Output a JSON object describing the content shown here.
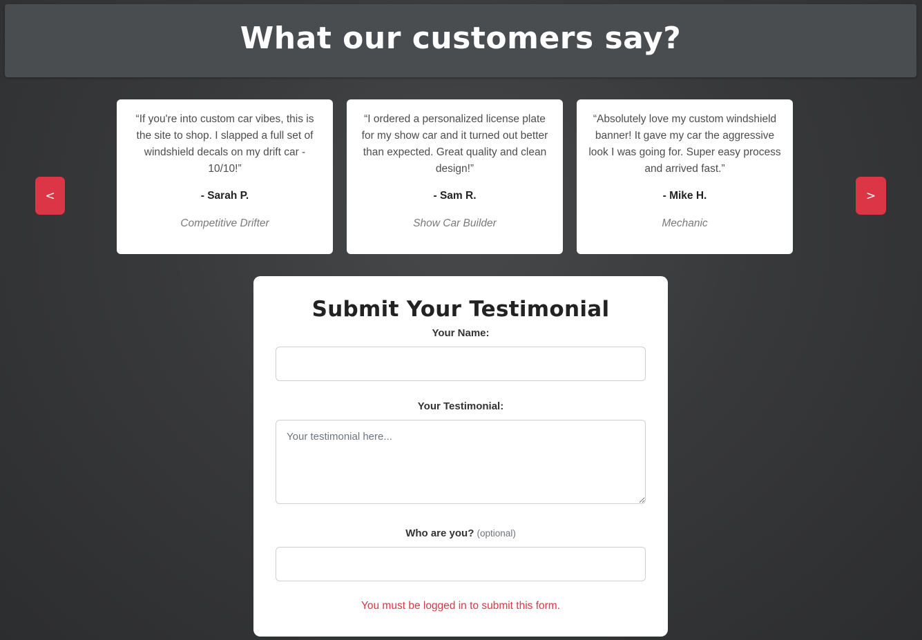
{
  "header": {
    "title": "What our customers say?"
  },
  "carousel": {
    "prev_label": "<",
    "next_label": ">",
    "testimonials": [
      {
        "quote": "“If you're into custom car vibes, this is the site to shop. I slapped a full set of windshield decals on my drift car - 10/10!”",
        "author": "- Sarah P.",
        "role": "Competitive Drifter"
      },
      {
        "quote": "“I ordered a personalized license plate for my show car and it turned out better than expected. Great quality and clean design!”",
        "author": "- Sam R.",
        "role": "Show Car Builder"
      },
      {
        "quote": "“Absolutely love my custom windshield banner! It gave my car the aggressive look I was going for. Super easy process and arrived fast.”",
        "author": "- Mike H.",
        "role": "Mechanic"
      }
    ]
  },
  "form": {
    "title": "Submit Your Testimonial",
    "name_label": "Your Name:",
    "name_value": "",
    "testimonial_label": "Your Testimonial:",
    "testimonial_placeholder": "Your testimonial here...",
    "who_label": "Who are you?",
    "who_optional": "(optional)",
    "who_value": "",
    "login_message": "You must be logged in to submit this form."
  },
  "colors": {
    "accent": "#dc3545",
    "background": "#38393b",
    "header_bg": "#4a4d50",
    "card_bg": "#ffffff"
  },
  "icons": {
    "prev": "chevron-left-icon",
    "next": "chevron-right-icon"
  }
}
